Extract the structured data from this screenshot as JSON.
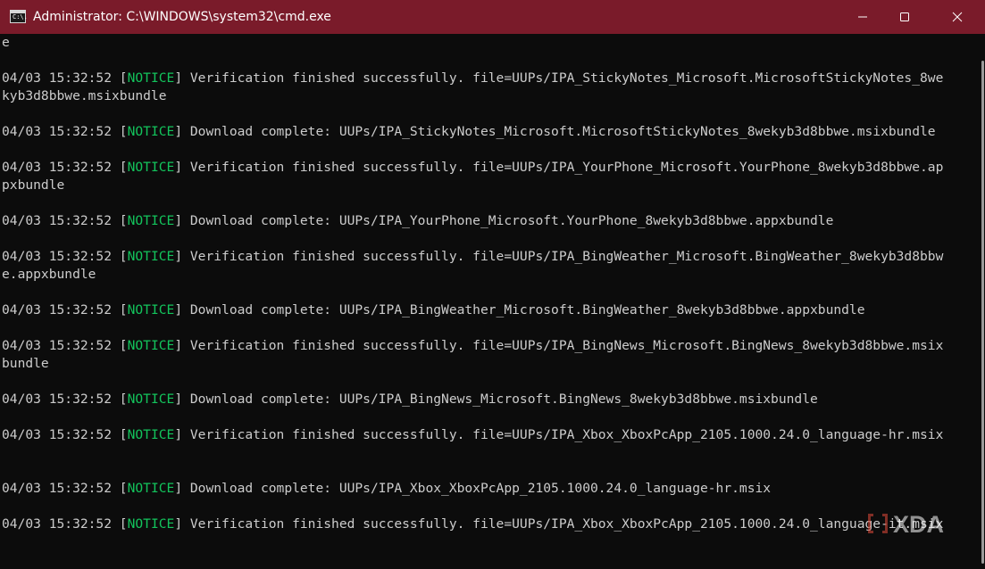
{
  "window": {
    "title": "Administrator: C:\\WINDOWS\\system32\\cmd.exe",
    "icon_text": "C:\\."
  },
  "colors": {
    "titlebar": "#7a1b2a",
    "console_bg": "#0c0c0c",
    "console_text": "#cccccc",
    "notice": "#13c45c"
  },
  "console": {
    "lines": [
      {
        "plain": "e"
      },
      {
        "pre": "04/03 15:32:52 [",
        "tag": "NOTICE",
        "post": "] Verification finished successfully. file=UUPs/IPA_StickyNotes_Microsoft.MicrosoftStickyNotes_8we"
      },
      {
        "plain": "kyb3d8bbwe.msixbundle"
      },
      {
        "pre": "04/03 15:32:52 [",
        "tag": "NOTICE",
        "post": "] Download complete: UUPs/IPA_StickyNotes_Microsoft.MicrosoftStickyNotes_8wekyb3d8bbwe.msixbundle"
      },
      {
        "pre": "04/03 15:32:52 [",
        "tag": "NOTICE",
        "post": "] Verification finished successfully. file=UUPs/IPA_YourPhone_Microsoft.YourPhone_8wekyb3d8bbwe.ap"
      },
      {
        "plain": "pxbundle"
      },
      {
        "pre": "04/03 15:32:52 [",
        "tag": "NOTICE",
        "post": "] Download complete: UUPs/IPA_YourPhone_Microsoft.YourPhone_8wekyb3d8bbwe.appxbundle"
      },
      {
        "pre": "04/03 15:32:52 [",
        "tag": "NOTICE",
        "post": "] Verification finished successfully. file=UUPs/IPA_BingWeather_Microsoft.BingWeather_8wekyb3d8bbw"
      },
      {
        "plain": "e.appxbundle"
      },
      {
        "pre": "04/03 15:32:52 [",
        "tag": "NOTICE",
        "post": "] Download complete: UUPs/IPA_BingWeather_Microsoft.BingWeather_8wekyb3d8bbwe.appxbundle"
      },
      {
        "pre": "04/03 15:32:52 [",
        "tag": "NOTICE",
        "post": "] Verification finished successfully. file=UUPs/IPA_BingNews_Microsoft.BingNews_8wekyb3d8bbwe.msix"
      },
      {
        "plain": "bundle"
      },
      {
        "pre": "04/03 15:32:52 [",
        "tag": "NOTICE",
        "post": "] Download complete: UUPs/IPA_BingNews_Microsoft.BingNews_8wekyb3d8bbwe.msixbundle"
      },
      {
        "pre": "04/03 15:32:52 [",
        "tag": "NOTICE",
        "post": "] Verification finished successfully. file=UUPs/IPA_Xbox_XboxPcApp_2105.1000.24.0_language-hr.msix"
      },
      {
        "pre": "04/03 15:32:52 [",
        "tag": "NOTICE",
        "post": "] Download complete: UUPs/IPA_Xbox_XboxPcApp_2105.1000.24.0_language-hr.msix"
      },
      {
        "pre": "04/03 15:32:52 [",
        "tag": "NOTICE",
        "post": "] Verification finished successfully. file=UUPs/IPA_Xbox_XboxPcApp_2105.1000.24.0_language-it.msix"
      }
    ]
  },
  "watermark": {
    "text": "XDA"
  }
}
